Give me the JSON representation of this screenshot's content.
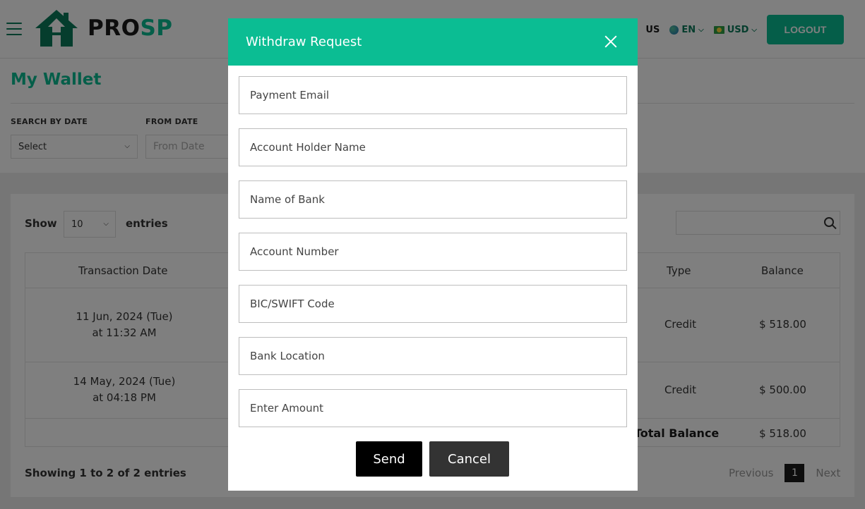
{
  "header": {
    "logo_part1": "PRO",
    "logo_part2": "SP",
    "nav_partial": "US",
    "language": "EN",
    "currency": "USD",
    "logout_label": "LOGOUT"
  },
  "page": {
    "title": "My Wallet",
    "filters": {
      "search_by_date_label": "SEARCH BY DATE",
      "search_by_date_value": "Select",
      "from_date_label": "FROM DATE",
      "from_date_placeholder": "From Date"
    }
  },
  "table": {
    "show_label": "Show",
    "entries_value": "10",
    "entries_label": "entries",
    "columns": [
      "Transaction Date",
      "Type",
      "Balance"
    ],
    "rows": [
      {
        "date": "11 Jun, 2024 (Tue)",
        "time": "at 11:32 AM",
        "type": "Credit",
        "balance": "$ 518.00"
      },
      {
        "date": "14 May, 2024 (Tue)",
        "time": "at 04:18 PM",
        "type": "Credit",
        "balance": "$ 500.00"
      }
    ],
    "total_label": "Total Balance",
    "total_value": "$ 518.00",
    "showing_text": "Showing 1 to 2 of 2 entries",
    "pagination": {
      "previous": "Previous",
      "current": "1",
      "next": "Next"
    }
  },
  "modal": {
    "title": "Withdraw Request",
    "fields": {
      "payment_email": "Payment Email",
      "account_holder_name": "Account Holder Name",
      "name_of_bank": "Name of Bank",
      "account_number": "Account Number",
      "bic_swift_code": "BIC/SWIFT Code",
      "bank_location": "Bank Location",
      "enter_amount": "Enter Amount"
    },
    "send_label": "Send",
    "cancel_label": "Cancel"
  },
  "colors": {
    "accent": "#0bbd93",
    "dark_accent": "#0a7a5a",
    "overlay": "rgba(0,0,0,0.5)"
  }
}
